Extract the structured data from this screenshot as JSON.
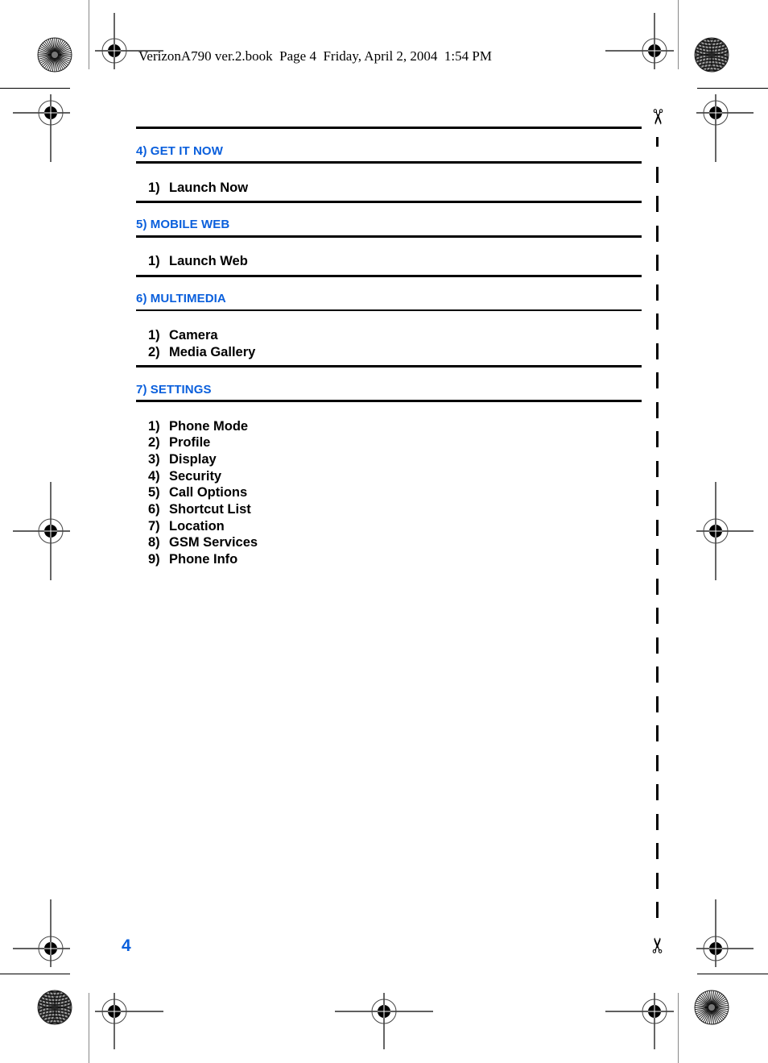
{
  "header": {
    "text": "VerizonA790 ver.2.book  Page 4  Friday, April 2, 2004  1:54 PM"
  },
  "sections": [
    {
      "title": "4) GET IT NOW",
      "items": [
        {
          "num": "1)",
          "label": "Launch Now"
        }
      ]
    },
    {
      "title": "5) MOBILE WEB",
      "items": [
        {
          "num": "1)",
          "label": "Launch Web"
        }
      ]
    },
    {
      "title": "6) MULTIMEDIA",
      "items": [
        {
          "num": "1)",
          "label": "Camera"
        },
        {
          "num": "2)",
          "label": "Media Gallery"
        }
      ]
    },
    {
      "title": "7) SETTINGS",
      "items": [
        {
          "num": "1)",
          "label": "Phone Mode"
        },
        {
          "num": "2)",
          "label": "Profile"
        },
        {
          "num": "3)",
          "label": "Display"
        },
        {
          "num": "4)",
          "label": "Security"
        },
        {
          "num": "5)",
          "label": "Call Options"
        },
        {
          "num": "6)",
          "label": "Shortcut List"
        },
        {
          "num": "7)",
          "label": "Location"
        },
        {
          "num": "8)",
          "label": "GSM Services"
        },
        {
          "num": "9)",
          "label": "Phone Info"
        }
      ]
    }
  ],
  "footer": {
    "page_number": "4"
  },
  "icons": {
    "scissors_top": "✂",
    "scissors_bottom": "✂"
  },
  "colors": {
    "accent": "#0a5fdc",
    "text": "#000000"
  }
}
